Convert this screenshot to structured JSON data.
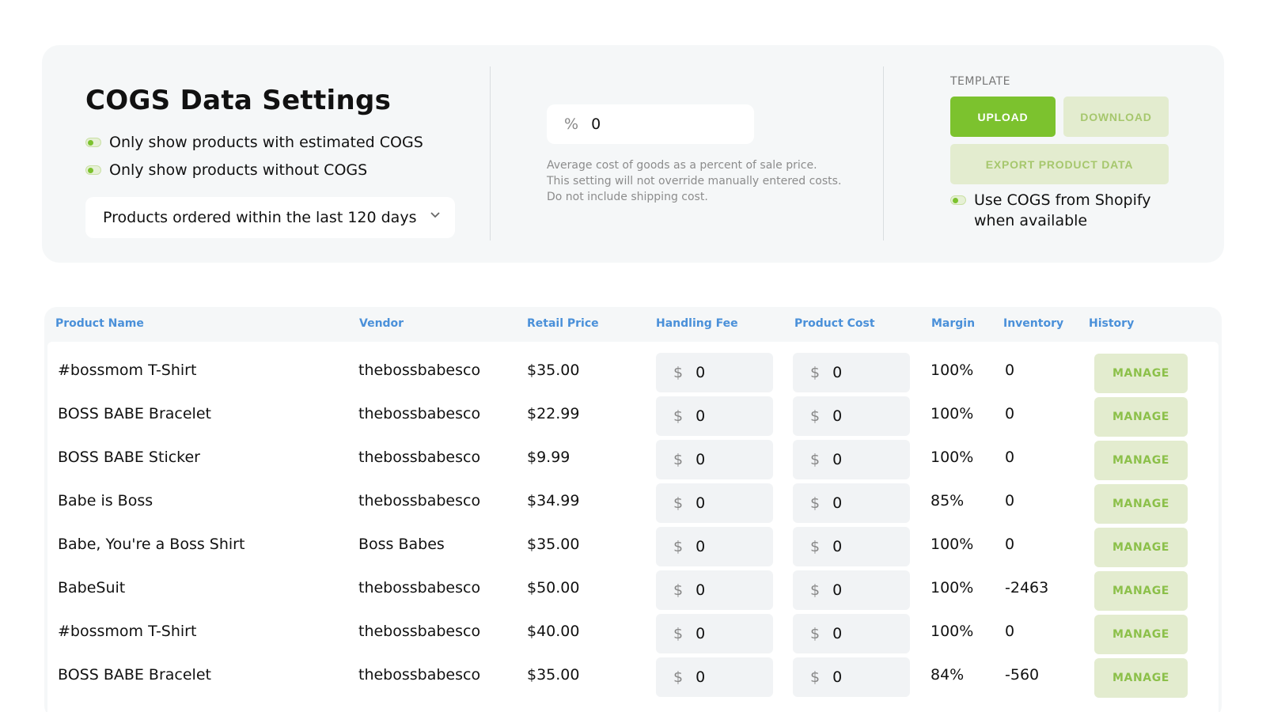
{
  "settings": {
    "title": "COGS Data Settings",
    "toggle_estimated": "Only show products with estimated COGS",
    "toggle_without": "Only show products without COGS",
    "date_filter": "Products ordered within the last 120 days",
    "percent_symbol": "%",
    "percent_value": "0",
    "help_line1": "Average cost of goods as a percent of sale price.",
    "help_line2": "This setting will not override manually entered costs.",
    "help_line3": "Do not include shipping cost.",
    "template_label": "TEMPLATE",
    "upload_label": "UPLOAD",
    "download_label": "DOWNLOAD",
    "export_label": "EXPORT PRODUCT DATA",
    "shopify_toggle_label": "Use COGS from Shopify when available"
  },
  "table": {
    "headers": [
      "Product Name",
      "Vendor",
      "Retail Price",
      "Handling Fee",
      "Product Cost",
      "Margin",
      "Inventory",
      "History"
    ],
    "currency_symbol": "$",
    "manage_label": "MANAGE",
    "rows": [
      {
        "name": "#bossmom T-Shirt",
        "vendor": "thebossbabesco",
        "price": "$35.00",
        "handling": "0",
        "cost": "0",
        "margin": "100%",
        "inventory": "0"
      },
      {
        "name": "BOSS BABE Bracelet",
        "vendor": "thebossbabesco",
        "price": "$22.99",
        "handling": "0",
        "cost": "0",
        "margin": "100%",
        "inventory": "0"
      },
      {
        "name": "BOSS BABE Sticker",
        "vendor": "thebossbabesco",
        "price": "$9.99",
        "handling": "0",
        "cost": "0",
        "margin": "100%",
        "inventory": "0"
      },
      {
        "name": "Babe is Boss",
        "vendor": "thebossbabesco",
        "price": "$34.99",
        "handling": "0",
        "cost": "0",
        "margin": "85%",
        "inventory": "0"
      },
      {
        "name": "Babe, You're a Boss Shirt",
        "vendor": "Boss Babes",
        "price": "$35.00",
        "handling": "0",
        "cost": "0",
        "margin": "100%",
        "inventory": "0"
      },
      {
        "name": "BabeSuit",
        "vendor": "thebossbabesco",
        "price": "$50.00",
        "handling": "0",
        "cost": "0",
        "margin": "100%",
        "inventory": "-2463"
      },
      {
        "name": "#bossmom T-Shirt",
        "vendor": "thebossbabesco",
        "price": "$40.00",
        "handling": "0",
        "cost": "0",
        "margin": "100%",
        "inventory": "0"
      },
      {
        "name": "BOSS BABE Bracelet",
        "vendor": "thebossbabesco",
        "price": "$35.00",
        "handling": "0",
        "cost": "0",
        "margin": "84%",
        "inventory": "-560"
      }
    ]
  },
  "colors": {
    "accent_green": "#7cc22e",
    "header_blue": "#4a90d9"
  }
}
